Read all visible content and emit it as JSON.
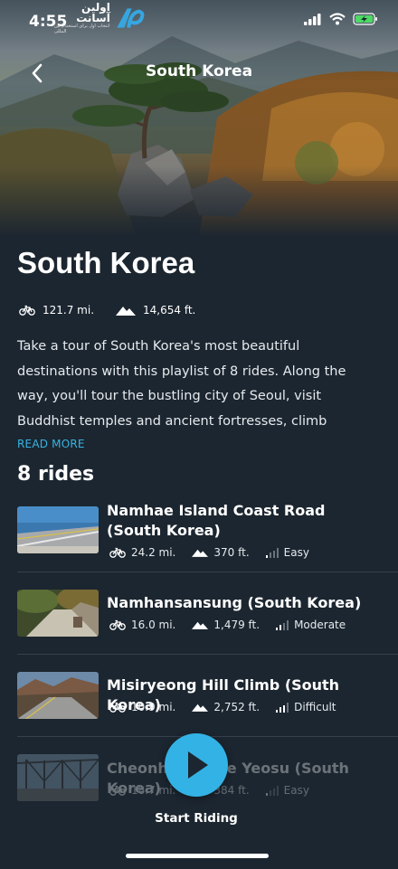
{
  "status_bar": {
    "time": "4:55"
  },
  "watermark": {
    "text": "اولین آسانت",
    "subtitle": "انتخاب اول برای استخدام بین المللی"
  },
  "header": {
    "title": "South Korea"
  },
  "playlist": {
    "title": "South Korea",
    "distance": "121.7 mi.",
    "elevation": "14,654 ft.",
    "description": "Take a tour of South Korea's most beautiful destinations with this playlist of 8 rides. Along the way, you'll tour the bustling city of Seoul, visit Buddhist temples and ancient fortresses, climb",
    "read_more": "READ MORE",
    "rides_heading": "8 rides"
  },
  "rides": [
    {
      "name": "Namhae Island Coast Road (South Korea)",
      "distance": "24.2 mi.",
      "elevation": "370 ft.",
      "difficulty": "Easy",
      "difficulty_level": 1
    },
    {
      "name": "Namhansansung (South Korea)",
      "distance": "16.0 mi.",
      "elevation": "1,479 ft.",
      "difficulty": "Moderate",
      "difficulty_level": 2
    },
    {
      "name": "Misiryeong Hill Climb (South Korea)",
      "distance": "10.9 mi.",
      "elevation": "2,752 ft.",
      "difficulty": "Difficult",
      "difficulty_level": 3
    },
    {
      "name": "Cheonho Bridge Yeosu (South Korea)",
      "distance": "18.7 mi.",
      "elevation": "384 ft.",
      "difficulty": "Easy",
      "difficulty_level": 1
    }
  ],
  "footer": {
    "start_label": "Start Riding"
  },
  "colors": {
    "background": "#1c2630",
    "accent": "#33b2e5",
    "link": "#37b3e2",
    "battery": "#4cd964"
  }
}
